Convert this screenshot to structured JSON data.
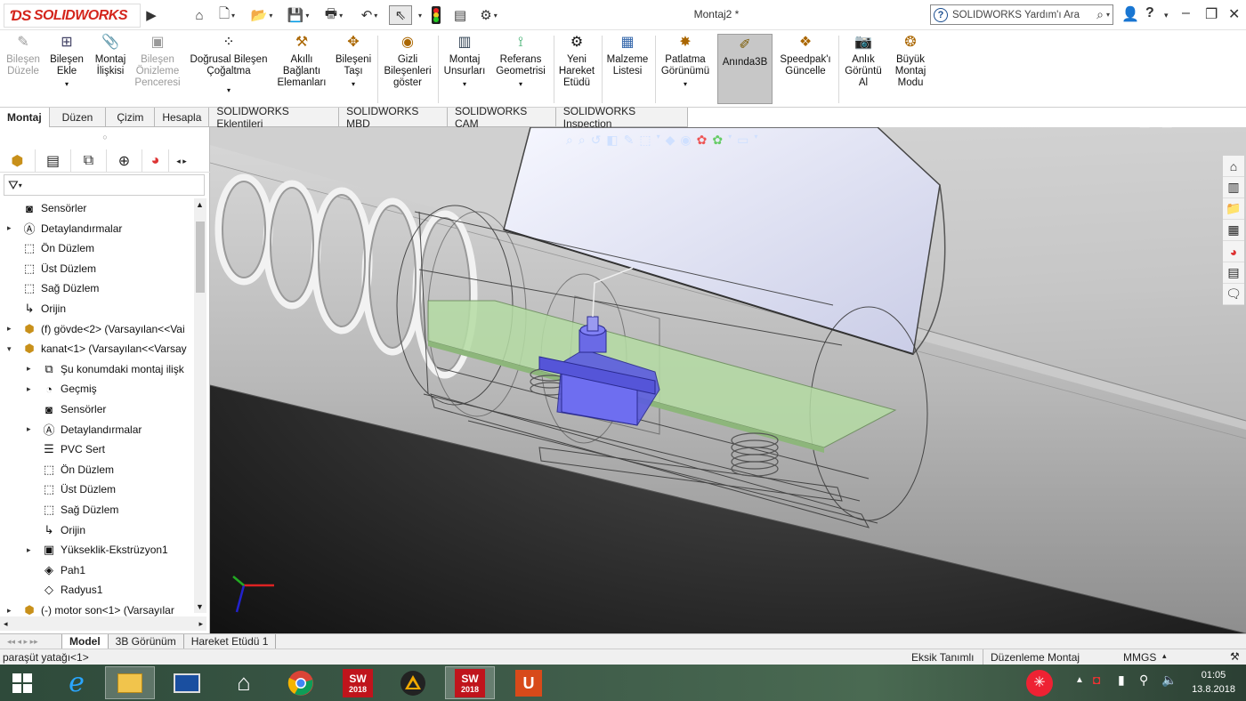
{
  "app": {
    "logo": "SOLIDWORKS",
    "doc_title": "Montaj2 *",
    "help_placeholder": "SOLIDWORKS Yardım'ı Ara"
  },
  "ribbon": [
    {
      "key": "edit_component",
      "label": "Bileşen Düzele",
      "enabled": false
    },
    {
      "key": "insert_component",
      "label": "Bileşen Ekle",
      "enabled": true
    },
    {
      "key": "mate",
      "label": "Montaj İlişkisi",
      "enabled": true
    },
    {
      "key": "component_preview",
      "label": "Bileşen Önizleme Penceresi",
      "enabled": false
    },
    {
      "key": "linear_pattern",
      "label": "Doğrusal Bileşen Çoğaltma",
      "enabled": true
    },
    {
      "key": "smart_fasteners",
      "label": "Akıllı Bağlantı Elemanları",
      "enabled": true
    },
    {
      "key": "move_component",
      "label": "Bileşeni Taşı",
      "enabled": true
    },
    {
      "key": "show_hidden",
      "label": "Gizli Bileşenleri göster",
      "enabled": true
    },
    {
      "key": "assembly_features",
      "label": "Montaj Unsurları",
      "enabled": true
    },
    {
      "key": "reference_geometry",
      "label": "Referans Geometrisi",
      "enabled": true
    },
    {
      "key": "new_motion_study",
      "label": "Yeni Hareket Etüdü",
      "enabled": true
    },
    {
      "key": "bom",
      "label": "Malzeme Listesi",
      "enabled": true
    },
    {
      "key": "exploded_view",
      "label": "Patlatma Görünümü",
      "enabled": true
    },
    {
      "key": "instant3d",
      "label": "Anında3B",
      "enabled": true
    },
    {
      "key": "update_speedpak",
      "label": "Speedpak'ı Güncelle",
      "enabled": true
    },
    {
      "key": "take_snapshot",
      "label": "Anlık Görüntü Al",
      "enabled": true
    },
    {
      "key": "large_assembly",
      "label": "Büyük Montaj Modu",
      "enabled": true
    }
  ],
  "command_tabs": [
    "Montaj",
    "Düzen",
    "Çizim",
    "Hesapla",
    "SOLIDWORKS Eklentileri",
    "SOLIDWORKS MBD",
    "SOLIDWORKS CAM",
    "SOLIDWORKS Inspection"
  ],
  "tree": [
    {
      "label": "Sensörler",
      "icon": "sensor-icon",
      "level": 1,
      "expand": false
    },
    {
      "label": "Detaylandırmalar",
      "icon": "annotations-icon",
      "level": 1,
      "expand": true
    },
    {
      "label": "Ön Düzlem",
      "icon": "plane-icon",
      "level": 1,
      "expand": false
    },
    {
      "label": "Üst Düzlem",
      "icon": "plane-icon",
      "level": 1,
      "expand": false
    },
    {
      "label": "Sağ Düzlem",
      "icon": "plane-icon",
      "level": 1,
      "expand": false
    },
    {
      "label": "Orijin",
      "icon": "origin-icon",
      "level": 1,
      "expand": false
    },
    {
      "label": "(f) gövde<2> (Varsayılan<<Vai",
      "icon": "part-icon",
      "level": 1,
      "expand": true
    },
    {
      "label": "kanat<1> (Varsayılan<<Varsay",
      "icon": "part-icon",
      "level": 1,
      "expand": "open"
    },
    {
      "label": "Şu konumdaki montaj ilişk",
      "icon": "mates-icon",
      "level": 2,
      "expand": true
    },
    {
      "label": "Geçmiş",
      "icon": "history-icon",
      "level": 2,
      "expand": true
    },
    {
      "label": "Sensörler",
      "icon": "sensor-icon",
      "level": 2,
      "expand": false
    },
    {
      "label": "Detaylandırmalar",
      "icon": "annotations-icon",
      "level": 2,
      "expand": true
    },
    {
      "label": "PVC Sert",
      "icon": "material-icon",
      "level": 2,
      "expand": false
    },
    {
      "label": "Ön Düzlem",
      "icon": "plane-icon",
      "level": 2,
      "expand": false
    },
    {
      "label": "Üst Düzlem",
      "icon": "plane-icon",
      "level": 2,
      "expand": false
    },
    {
      "label": "Sağ Düzlem",
      "icon": "plane-icon",
      "level": 2,
      "expand": false
    },
    {
      "label": "Orijin",
      "icon": "origin-icon",
      "level": 2,
      "expand": false
    },
    {
      "label": "Yükseklik-Ekstrüzyon1",
      "icon": "extrude-icon",
      "level": 2,
      "expand": true
    },
    {
      "label": "Pah1",
      "icon": "chamfer-icon",
      "level": 2,
      "expand": false
    },
    {
      "label": "Radyus1",
      "icon": "fillet-icon",
      "level": 2,
      "expand": false
    },
    {
      "label": "(-) motor     son<1> (Varsayılar",
      "icon": "part-icon",
      "level": 1,
      "expand": true
    }
  ],
  "bottom_tabs": [
    "Model",
    "3B Görünüm",
    "Hareket Etüdü 1"
  ],
  "status": {
    "left": "paraşüt yatağı<1>",
    "underdefined": "Eksik Tanımlı",
    "editing": "Düzenleme Montaj",
    "units": "MMGS"
  },
  "clock": {
    "time": "01:05",
    "date": "13.8.2018"
  },
  "taskbar_badge": "2018"
}
